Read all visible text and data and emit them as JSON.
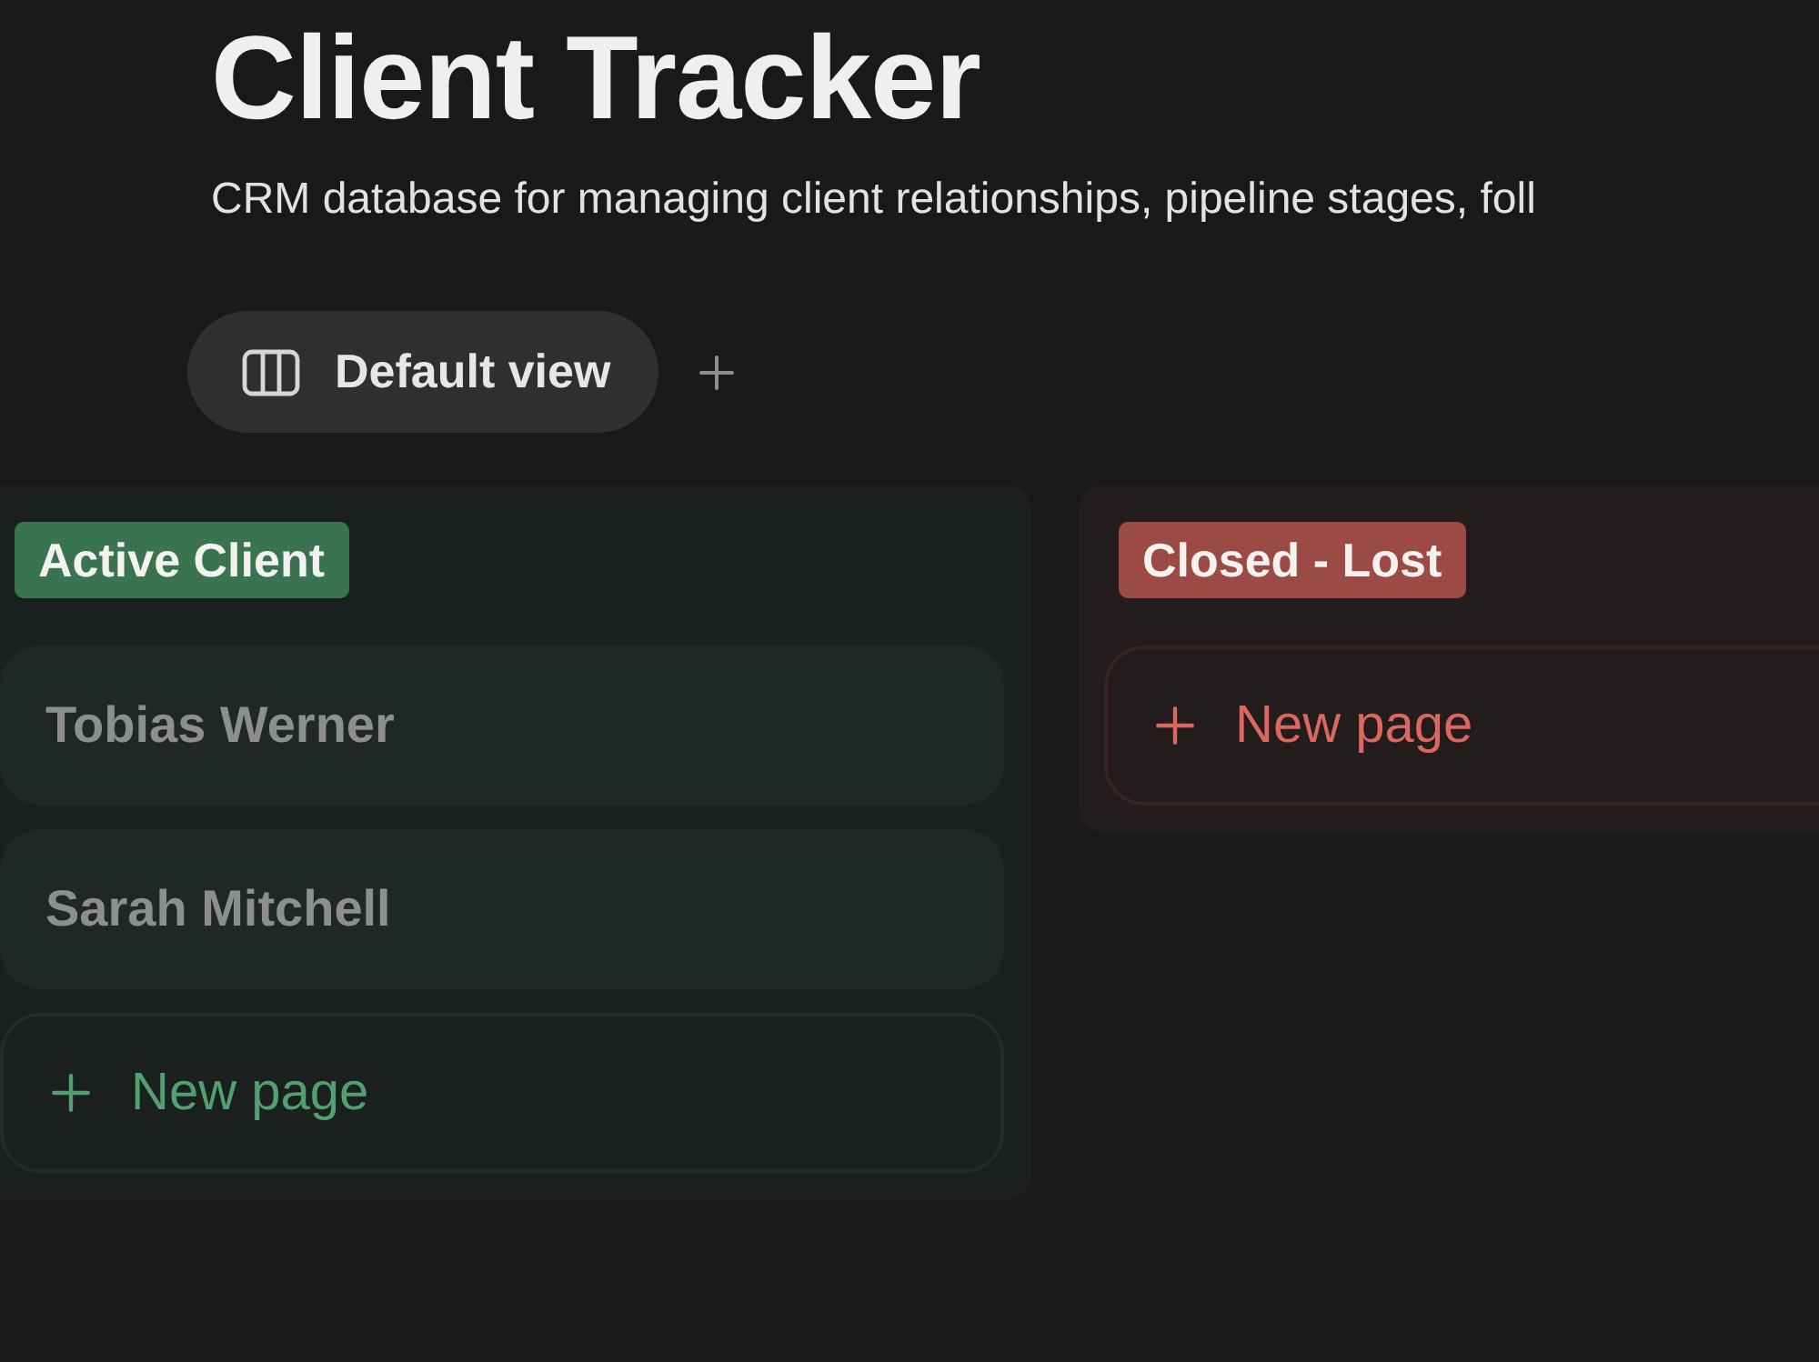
{
  "page": {
    "title": "Client Tracker",
    "description": "CRM database for managing client relationships, pipeline stages, foll"
  },
  "views": [
    {
      "label": "Default view",
      "selected": true
    }
  ],
  "board": {
    "groups": [
      {
        "label": "Active Client",
        "color": "#3a7350",
        "cards": [
          {
            "title": "Tobias Werner"
          },
          {
            "title": "Sarah Mitchell"
          }
        ],
        "new_page_label": "New page"
      },
      {
        "label": "Closed - Lost",
        "color": "#9c4a44",
        "new_page_label": "New page"
      }
    ]
  }
}
